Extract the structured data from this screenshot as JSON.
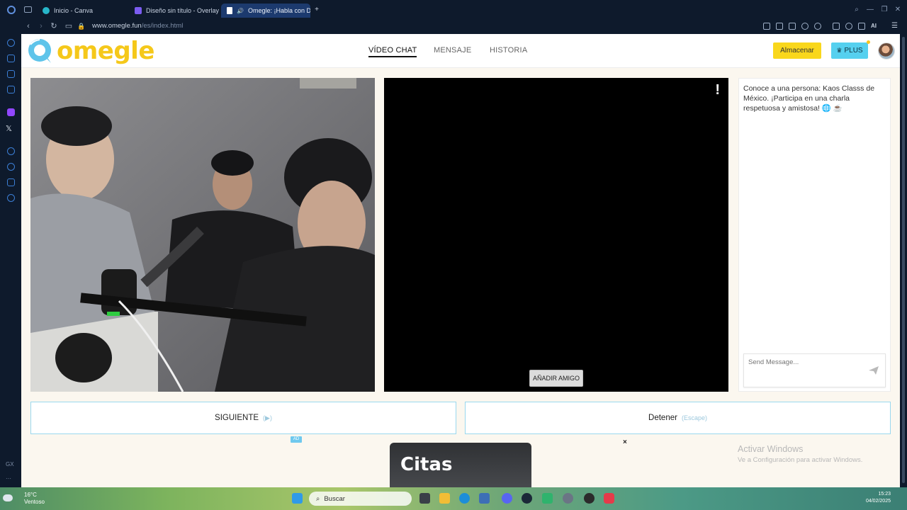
{
  "browser": {
    "tabs": [
      {
        "label": "Inicio - Canva",
        "active": false
      },
      {
        "label": "Diseño sin título - Overlay",
        "active": false
      },
      {
        "label": "Omegle: ¡Habla con De",
        "active": true
      }
    ],
    "url_host": "www.omegle.fun",
    "url_path": "/es/index.html"
  },
  "site": {
    "logo_text": "omegle",
    "nav": [
      {
        "label": "VÍDEO CHAT",
        "active": true
      },
      {
        "label": "MENSAJE",
        "active": false
      },
      {
        "label": "HISTORIA",
        "active": false
      }
    ],
    "almacenar_label": "Almacenar",
    "plus_label": "PLUS"
  },
  "video": {
    "warning_glyph": "!",
    "add_friend_label": "AÑADIR AMIGO"
  },
  "chat": {
    "message": "Conoce a una persona: Kaos Classs de México. ¡Participa en una charla respetuosa y amistosa! 🌐 ☕",
    "input_placeholder": "Send Message..."
  },
  "controls": {
    "next_label": "SIGUIENTE",
    "next_hint": "(▶)",
    "stop_label": "Detener",
    "stop_hint": "(Escape)"
  },
  "ad": {
    "badge": "AD",
    "title": "Citas",
    "close": "×"
  },
  "watermark": {
    "line1": "Activar Windows",
    "line2": "Ve a Configuración para activar Windows."
  },
  "taskbar": {
    "temperature": "16°C",
    "condition": "Ventoso",
    "search_label": "Buscar",
    "time": "15:23",
    "date": "04/02/2025"
  },
  "sidebar": {
    "gx_label": "GX",
    "more_label": "···"
  },
  "colors": {
    "accent_yellow": "#f9d71c",
    "accent_cyan": "#55d0ef",
    "page_bg": "#fbf7ef",
    "browser_bg": "#0e1a2c"
  }
}
